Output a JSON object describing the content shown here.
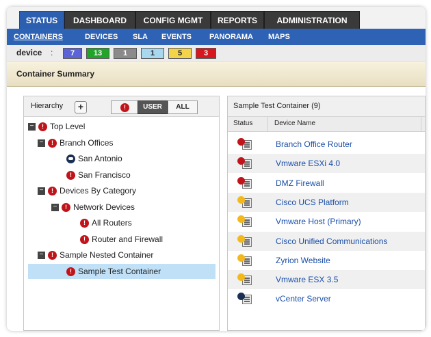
{
  "nav": {
    "top_tabs": [
      "STATUS",
      "DASHBOARD",
      "CONFIG MGMT",
      "REPORTS",
      "ADMINISTRATION"
    ],
    "sub_items": [
      "CONTAINERS",
      "DEVICES",
      "SLA",
      "EVENTS",
      "PANORAMA",
      "MAPS"
    ]
  },
  "device_status": {
    "label": "device",
    "separator": ":",
    "badges": [
      {
        "count": "7",
        "color": "#5b63d6"
      },
      {
        "count": "13",
        "color": "#22a32a"
      },
      {
        "count": "1",
        "color": "#8a8a8a"
      },
      {
        "count": "1",
        "color": "#a8d8f0"
      },
      {
        "count": "5",
        "color": "#f3d34a"
      },
      {
        "count": "3",
        "color": "#d6171d"
      }
    ]
  },
  "summary": {
    "title": "Container Summary"
  },
  "hierarchy": {
    "label": "Hierarchy",
    "plus": "+",
    "user_label": "USER",
    "all_label": "ALL",
    "nodes": [
      {
        "label": "Top Level",
        "status": "red",
        "expander": "−"
      },
      {
        "label": "Branch Offices",
        "status": "red",
        "expander": "−"
      },
      {
        "label": "San Antonio",
        "status": "blue",
        "expander": ""
      },
      {
        "label": "San Francisco",
        "status": "red",
        "expander": ""
      },
      {
        "label": "Devices By Category",
        "status": "red",
        "expander": "−"
      },
      {
        "label": "Network Devices",
        "status": "red",
        "expander": "−"
      },
      {
        "label": "All Routers",
        "status": "red",
        "expander": ""
      },
      {
        "label": "Router and Firewall",
        "status": "red",
        "expander": ""
      },
      {
        "label": "Sample Nested Container",
        "status": "red",
        "expander": "−"
      },
      {
        "label": "Sample Test Container",
        "status": "red",
        "expander": ""
      }
    ]
  },
  "container": {
    "title": "Sample Test Container (9)",
    "columns": [
      "Status",
      "Device Name"
    ],
    "devices": [
      {
        "name": "Branch Office Router",
        "status": "red"
      },
      {
        "name": "Vmware ESXi 4.0",
        "status": "red"
      },
      {
        "name": "DMZ Firewall",
        "status": "red"
      },
      {
        "name": "Cisco UCS Platform",
        "status": "yellow"
      },
      {
        "name": "Vmware Host (Primary)",
        "status": "yellow"
      },
      {
        "name": "Cisco Unified Communications",
        "status": "yellow"
      },
      {
        "name": "Zyrion Website",
        "status": "yellow"
      },
      {
        "name": "Vmware ESX 3.5",
        "status": "yellow"
      },
      {
        "name": "vCenter Server",
        "status": "blue"
      }
    ]
  }
}
